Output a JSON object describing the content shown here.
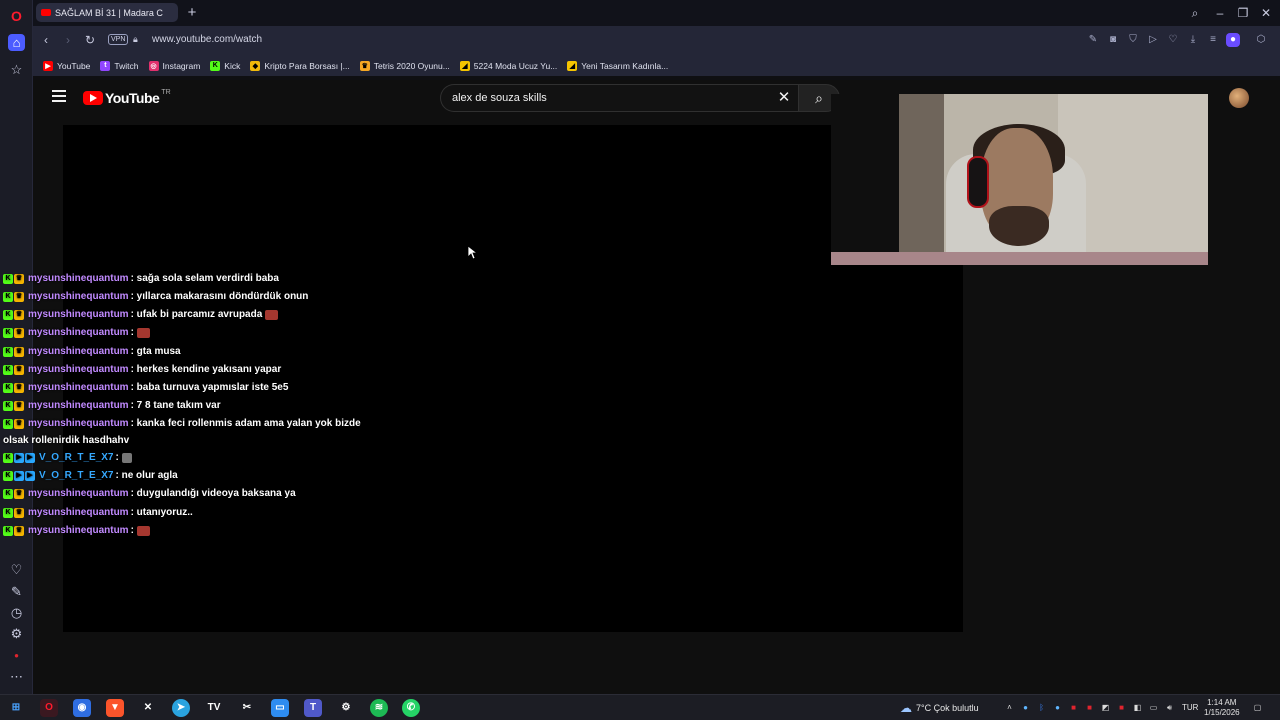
{
  "browser": {
    "tab_title": "SAĞLAM Bİ 31 | Madara C",
    "url": "www.youtube.com/watch",
    "vpn_label": "VPN"
  },
  "bookmarks": [
    {
      "label": "YouTube",
      "color": "#ff0000"
    },
    {
      "label": "Twitch",
      "color": "#9146ff"
    },
    {
      "label": "Instagram",
      "color": "#e1306c"
    },
    {
      "label": "Kick",
      "color": "#53fc18"
    },
    {
      "label": "Kripto Para Borsası |...",
      "color": "#f0b90b"
    },
    {
      "label": "Tetris 2020 Oyunu...",
      "color": "#f5a623"
    },
    {
      "label": "5224 Moda Ucuz Yu...",
      "color": "#f5c400"
    },
    {
      "label": "Yeni Tasarım Kadınla...",
      "color": "#f5c400"
    }
  ],
  "youtube": {
    "logo_text": "YouTube",
    "country_code": "TR",
    "search_value": "alex de souza skills"
  },
  "chat": [
    {
      "user": "mysunshinequantum",
      "message": ": sağa sola selam verdirdi baba",
      "badges": [
        "k",
        "y"
      ]
    },
    {
      "user": "mysunshinequantum",
      "message": ": yıllarca makarasını döndürdük onun",
      "badges": [
        "k",
        "y"
      ]
    },
    {
      "user": "mysunshinequantum",
      "message": ": ufak bi parcamız avrupada",
      "badges": [
        "k",
        "y"
      ],
      "emote": "red"
    },
    {
      "user": "mysunshinequantum",
      "message": ":",
      "badges": [
        "k",
        "y"
      ],
      "emote": "red"
    },
    {
      "user": "mysunshinequantum",
      "message": ": gta musa",
      "badges": [
        "k",
        "y"
      ]
    },
    {
      "user": "mysunshinequantum",
      "message": ": herkes kendine yakısanı yapar",
      "badges": [
        "k",
        "y"
      ]
    },
    {
      "user": "mysunshinequantum",
      "message": ": baba turnuva yapmıslar iste 5e5",
      "badges": [
        "k",
        "y"
      ]
    },
    {
      "user": "mysunshinequantum",
      "message": ": 7 8 tane takım var",
      "badges": [
        "k",
        "y"
      ]
    },
    {
      "user": "mysunshinequantum",
      "message": ": kanka feci rollenmis adam ama yalan yok bizde",
      "badges": [
        "k",
        "y"
      ]
    },
    {
      "user": "",
      "message": "olsak rollenirdik hasdhahv",
      "badges": []
    },
    {
      "user": "V_O_R_T_E_X7",
      "message": ":",
      "badges": [
        "k",
        "b",
        "b"
      ],
      "emote": "grey",
      "blue": true
    },
    {
      "user": "V_O_R_T_E_X7",
      "message": ": ne olur agla",
      "badges": [
        "k",
        "b",
        "b"
      ],
      "blue": true
    },
    {
      "user": "mysunshinequantum",
      "message": ": duygulandığı videoya baksana ya",
      "badges": [
        "k",
        "y"
      ]
    },
    {
      "user": "mysunshinequantum",
      "message": ": utanıyoruz..",
      "badges": [
        "k",
        "y"
      ]
    },
    {
      "user": "mysunshinequantum",
      "message": ":",
      "badges": [
        "k",
        "y"
      ],
      "emote": "red"
    }
  ],
  "taskbar": {
    "weather": "7°C  Çok bulutlu",
    "language": "TUR",
    "time": "1:14 AM",
    "date": "1/15/2026"
  }
}
